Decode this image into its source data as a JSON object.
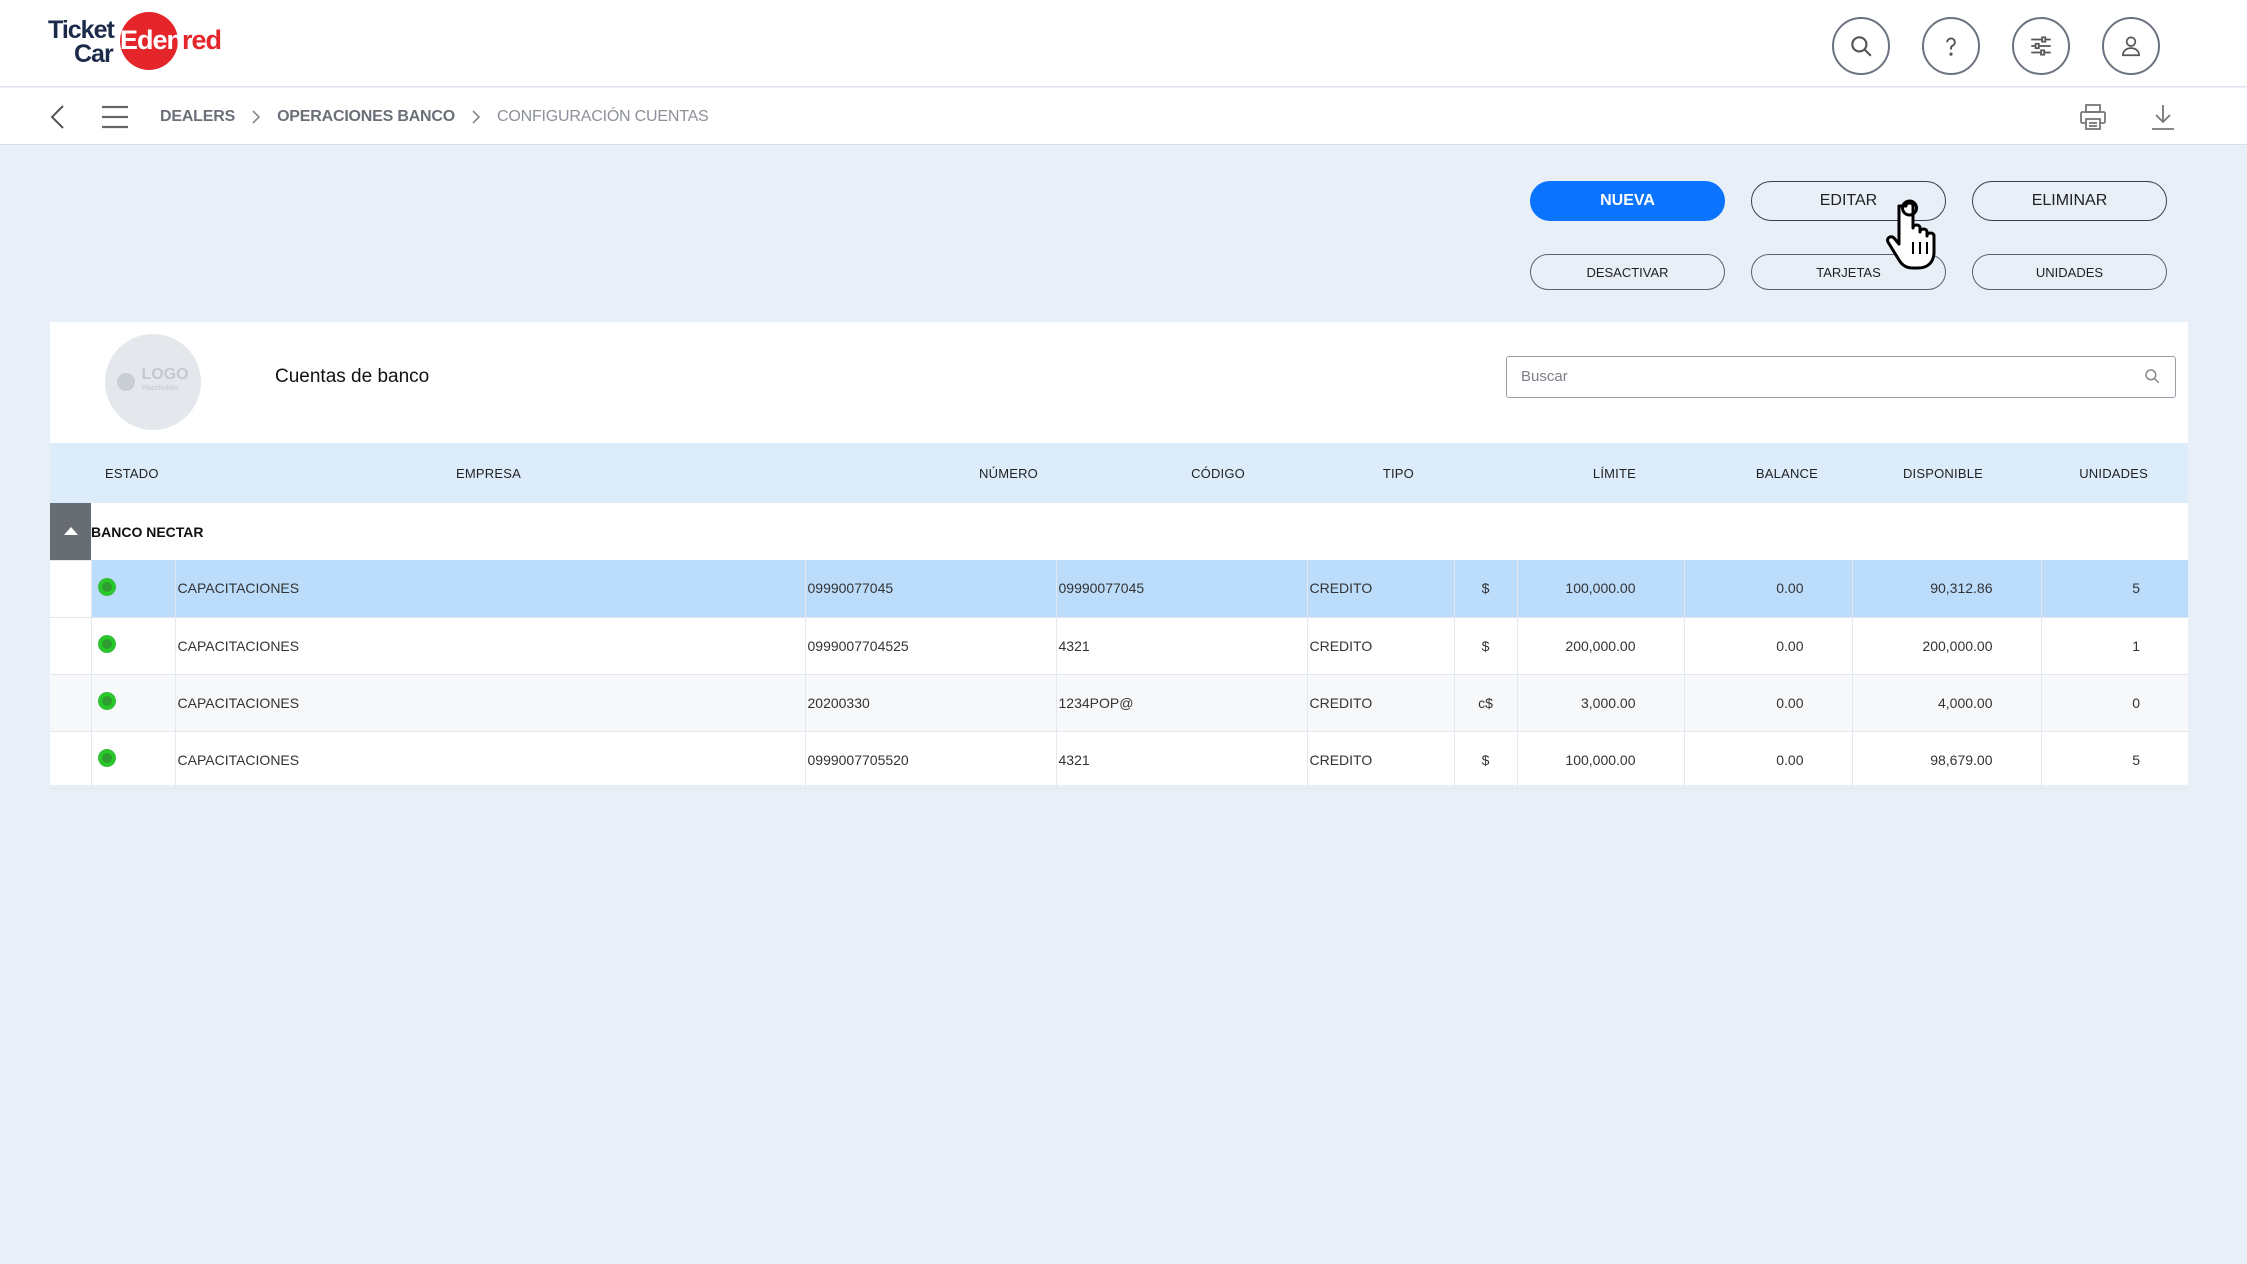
{
  "brand": {
    "line1": "Ticket",
    "line2": "Car",
    "mark_left": "Eden",
    "mark_right": "red"
  },
  "header_icons": [
    "search-icon",
    "help-icon",
    "sliders-icon",
    "user-icon"
  ],
  "breadcrumb": {
    "items": [
      "DEALERS",
      "OPERACIONES BANCO",
      "CONFIGURACIÓN CUENTAS"
    ]
  },
  "actions": {
    "primary": [
      "NUEVA",
      "EDITAR",
      "ELIMINAR"
    ],
    "secondary": [
      "DESACTIVAR",
      "TARJETAS",
      "UNIDADES"
    ]
  },
  "card": {
    "logo": {
      "main": "LOGO",
      "sub": "Placeholder"
    },
    "title": "Cuentas de banco",
    "search_placeholder": "Buscar"
  },
  "table": {
    "columns": [
      "ESTADO",
      "EMPRESA",
      "NÚMERO",
      "CÓDIGO",
      "TIPO",
      "LÍMITE",
      "BALANCE",
      "DISPONIBLE",
      "UNIDADES"
    ],
    "group": "BANCO NECTAR",
    "rows": [
      {
        "empresa": "CAPACITACIONES",
        "numero": "09990077045",
        "codigo": "09990077045",
        "tipo": "CREDITO",
        "moneda": "$",
        "limite": "100,000.00",
        "balance": "0.00",
        "disponible": "90,312.86",
        "unidades": "5"
      },
      {
        "empresa": "CAPACITACIONES",
        "numero": "0999007704525",
        "codigo": "4321",
        "tipo": "CREDITO",
        "moneda": "$",
        "limite": "200,000.00",
        "balance": "0.00",
        "disponible": "200,000.00",
        "unidades": "1"
      },
      {
        "empresa": "CAPACITACIONES",
        "numero": "20200330",
        "codigo": "1234POP@",
        "tipo": "CREDITO",
        "moneda": "c$",
        "limite": "3,000.00",
        "balance": "0.00",
        "disponible": "4,000.00",
        "unidades": "0"
      },
      {
        "empresa": "CAPACITACIONES",
        "numero": "0999007705520",
        "codigo": "4321",
        "tipo": "CREDITO",
        "moneda": "$",
        "limite": "100,000.00",
        "balance": "0.00",
        "disponible": "98,679.00",
        "unidades": "5"
      }
    ]
  },
  "colors": {
    "primary": "#0a74ff",
    "brand_red": "#e4262b",
    "selected_row": "#bcdcfb",
    "header_row": "#dcecfb",
    "status_active": "#2f9b30"
  }
}
